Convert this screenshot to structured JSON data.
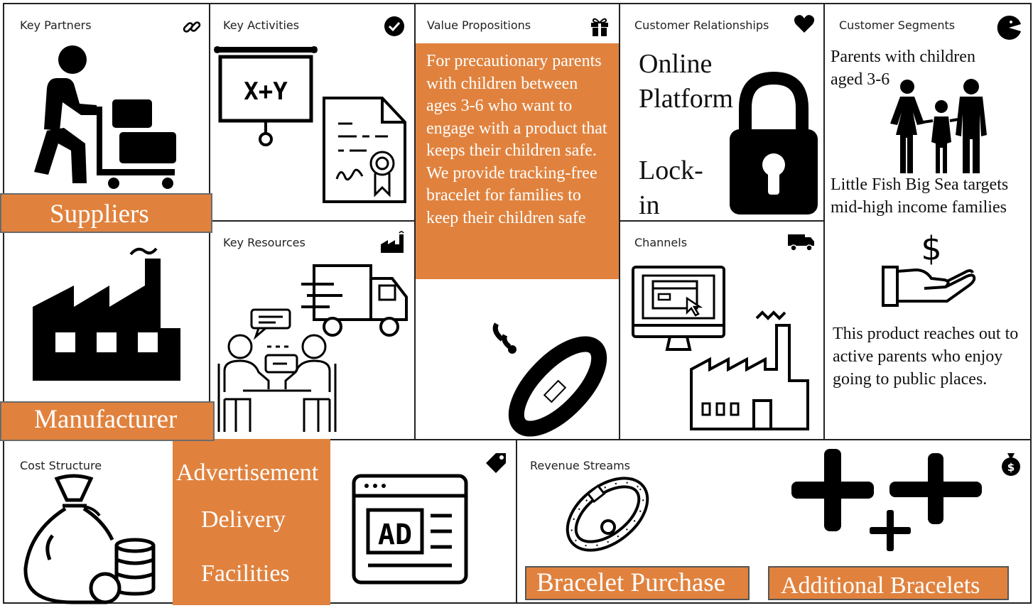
{
  "colors": {
    "accent": "#E0823E",
    "border": "#222222",
    "ink": "#000000"
  },
  "key_partners": {
    "header": "Key Partners",
    "icon": "link-icon",
    "items": [
      "Suppliers",
      "Manufacturer"
    ]
  },
  "key_activities": {
    "header": "Key Activities",
    "icon": "check-circle-icon",
    "board_text": "X+Y"
  },
  "key_resources": {
    "header": "Key Resources",
    "icon": "industry-icon"
  },
  "value_propositions": {
    "header": "Value Propositions",
    "icon": "gift-icon",
    "text": "For precautionary parents with children between ages 3-6 who want to engage with a product that keeps their children safe. We provide tracking-free bracelet for families to keep their children safe"
  },
  "customer_relationships": {
    "header": "Customer Relationships",
    "icon": "heart-icon",
    "items": [
      "Online Platform",
      "Lock-in"
    ]
  },
  "channels": {
    "header": "Channels",
    "icon": "truck-icon"
  },
  "customer_segments": {
    "header": "Customer Segments",
    "icon": "pacman-face-icon",
    "text1": "Parents with children aged 3-6",
    "text2": "Little Fish Big Sea targets mid-high income families",
    "text3": "This product reaches out to active parents who enjoy going to public places."
  },
  "cost_structure": {
    "header": "Cost Structure",
    "icon": "price-tag-icon",
    "items": [
      "Advertisement",
      "Delivery",
      "Facilities"
    ],
    "ad_text": "AD"
  },
  "revenue_streams": {
    "header": "Revenue Streams",
    "icon": "money-bag-icon",
    "items": [
      "Bracelet Purchase",
      "Additional Bracelets"
    ]
  }
}
